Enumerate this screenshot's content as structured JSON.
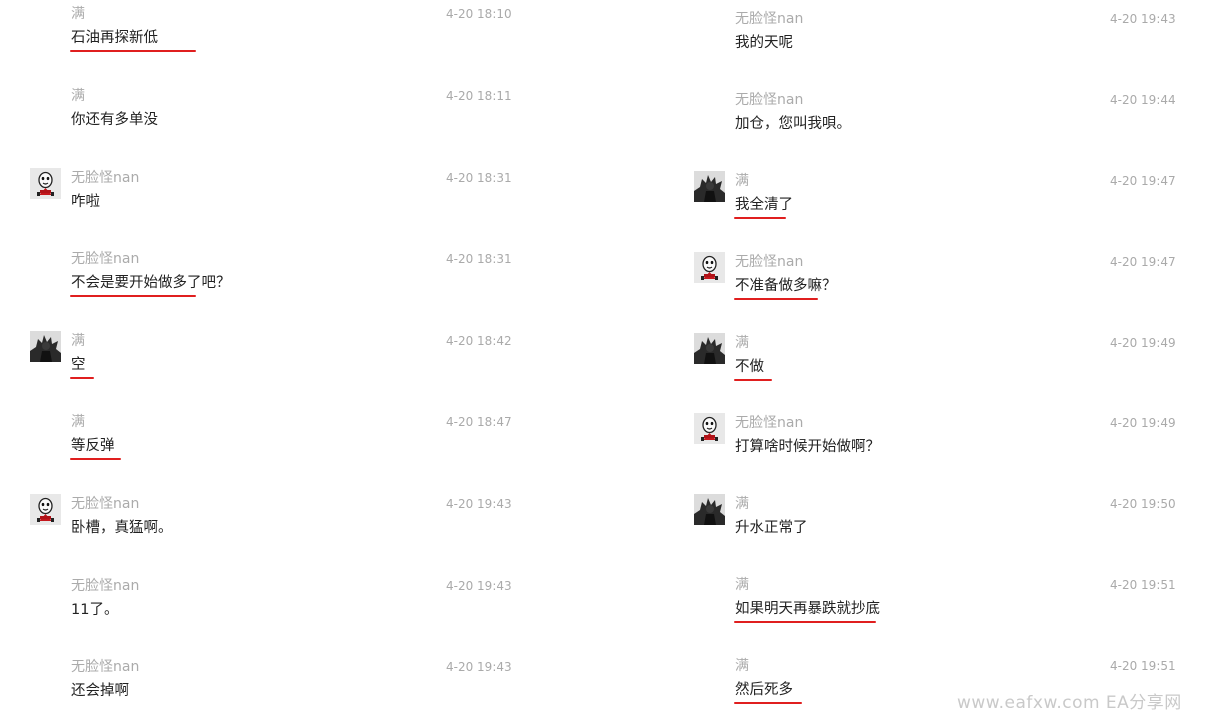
{
  "left_messages": [
    {
      "sender": "满",
      "time": "4-20 18:10",
      "text": "石油再探新低",
      "avatar": null,
      "underline": true
    },
    {
      "sender": "满",
      "time": "4-20 18:11",
      "text": "你还有多单没",
      "avatar": null,
      "underline": false
    },
    {
      "sender": "无脸怪nan",
      "time": "4-20 18:31",
      "text": "咋啦",
      "avatar": "mask-avatar",
      "underline": false
    },
    {
      "sender": "无脸怪nan",
      "time": "4-20 18:31",
      "text": "不会是要开始做多了吧？",
      "avatar": null,
      "underline": true
    },
    {
      "sender": "满",
      "time": "4-20 18:42",
      "text": "空",
      "avatar": "dark-avatar",
      "underline": true
    },
    {
      "sender": "满",
      "time": "4-20 18:47",
      "text": "等反弹",
      "avatar": null,
      "underline": true
    },
    {
      "sender": "无脸怪nan",
      "time": "4-20 19:43",
      "text": "卧槽，真猛啊。",
      "avatar": "mask-avatar",
      "underline": false
    },
    {
      "sender": "无脸怪nan",
      "time": "4-20 19:43",
      "text": "11了。",
      "avatar": null,
      "underline": false
    },
    {
      "sender": "无脸怪nan",
      "time": "4-20 19:43",
      "text": "还会掉啊",
      "avatar": null,
      "underline": false
    }
  ],
  "right_messages": [
    {
      "sender": "无脸怪nan",
      "time": "4-20 19:43",
      "text": "我的天呢",
      "avatar": null,
      "underline": false
    },
    {
      "sender": "无脸怪nan",
      "time": "4-20 19:44",
      "text": "加仓，您叫我唄。",
      "avatar": null,
      "underline": false
    },
    {
      "sender": "满",
      "time": "4-20 19:47",
      "text": "我全清了",
      "avatar": "dark-avatar",
      "underline": true
    },
    {
      "sender": "无脸怪nan",
      "time": "4-20 19:47",
      "text": "不准备做多嘛？",
      "avatar": "mask-avatar",
      "underline": true
    },
    {
      "sender": "满",
      "time": "4-20 19:49",
      "text": "不做",
      "avatar": "dark-avatar",
      "underline": true
    },
    {
      "sender": "无脸怪nan",
      "time": "4-20 19:49",
      "text": "打算啥时候开始做啊？",
      "avatar": "mask-avatar",
      "underline": false
    },
    {
      "sender": "满",
      "time": "4-20 19:50",
      "text": "升水正常了",
      "avatar": "dark-avatar",
      "underline": false
    },
    {
      "sender": "满",
      "time": "4-20 19:51",
      "text": "如果明天再暴跌就抄底",
      "avatar": null,
      "underline": true
    },
    {
      "sender": "满",
      "time": "4-20 19:51",
      "text": "然后死多",
      "avatar": null,
      "underline": true
    }
  ],
  "watermark": "www.eafxw.com  EA分享网",
  "colors": {
    "underline": "#e01f1f",
    "name": "#ababab",
    "time": "#aaaaaa",
    "text": "#222222"
  }
}
